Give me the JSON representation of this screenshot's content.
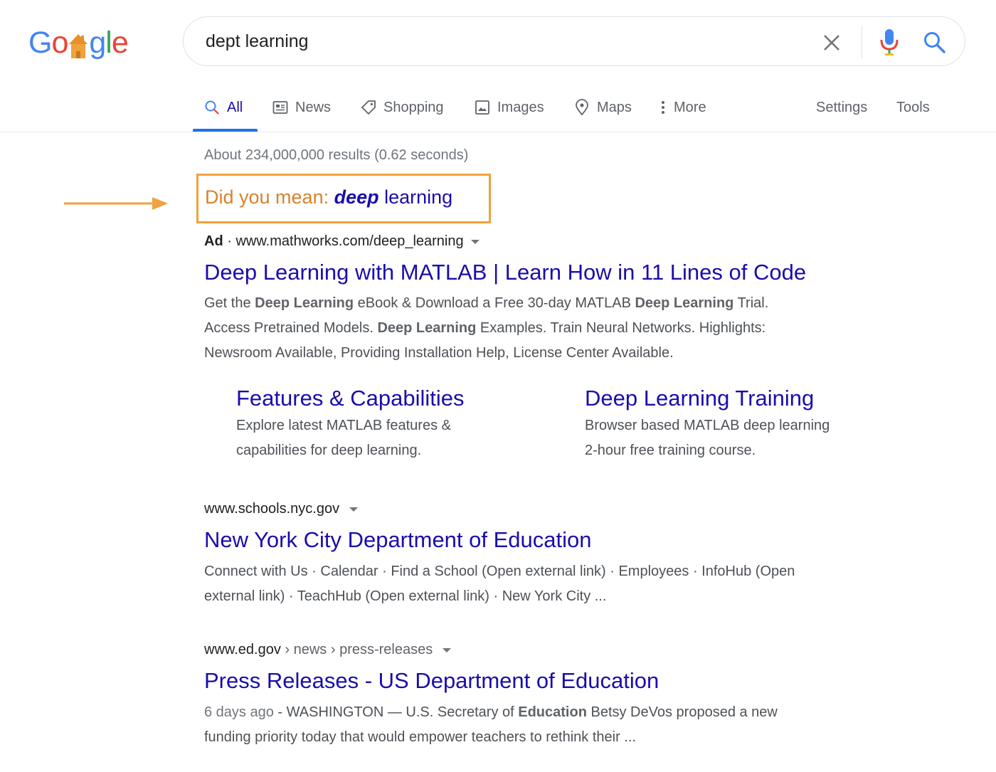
{
  "logo": {
    "letters": [
      "G",
      "o",
      "g",
      "l",
      "e"
    ],
    "colors": [
      "#4285f4",
      "#ea4335",
      "#fbbc05",
      "#4285f4",
      "#34a853",
      "#ea4335"
    ],
    "house_color": "#f0a23c"
  },
  "search": {
    "query": "dept learning"
  },
  "nav": {
    "tabs": [
      {
        "label": "All",
        "icon": "search-icon"
      },
      {
        "label": "News",
        "icon": "news-icon"
      },
      {
        "label": "Shopping",
        "icon": "tag-icon"
      },
      {
        "label": "Images",
        "icon": "image-icon"
      },
      {
        "label": "Maps",
        "icon": "map-pin-icon"
      },
      {
        "label": "More",
        "icon": "more-vert-icon"
      }
    ],
    "settings": "Settings",
    "tools": "Tools",
    "active_color": "#1a73e8"
  },
  "stats": "About 234,000,000 results (0.62 seconds)",
  "did_you_mean": {
    "prefix": "Did you mean: ",
    "bold_word": "deep",
    "rest": " learning",
    "highlight_color": "#f0a23c"
  },
  "ad": {
    "label": "Ad",
    "separator": " · ",
    "url": "www.mathworks.com/deep_learning",
    "title": "Deep Learning with MATLAB | Learn How in 11 Lines of Code",
    "snippet_lines": [
      [
        {
          "t": "Get the "
        },
        {
          "b": "Deep Learning"
        },
        {
          "t": " eBook & Download a Free 30-day MATLAB "
        },
        {
          "b": "Deep Learning"
        },
        {
          "t": " Trial."
        }
      ],
      [
        {
          "t": "Access Pretrained Models. "
        },
        {
          "b": "Deep Learning"
        },
        {
          "t": " Examples. Train Neural Networks. Highlights:"
        }
      ],
      [
        {
          "t": "Newsroom Available, Providing Installation Help, License Center Available."
        }
      ]
    ],
    "sitelinks": [
      {
        "title": "Features & Capabilities",
        "desc1": "Explore latest MATLAB features &",
        "desc2": "capabilities for deep learning."
      },
      {
        "title": "Deep Learning Training",
        "desc1": "Browser based MATLAB deep learning",
        "desc2": "2-hour free training course."
      }
    ]
  },
  "results": [
    {
      "url": "www.schools.nyc.gov",
      "crumbs": "",
      "title": "New York City Department of Education",
      "line1": "Connect with Us · Calendar · Find a School (Open external link) · Employees · InfoHub (Open",
      "line2": "external link) · TeachHub (Open external link) · New York City ..."
    },
    {
      "url": "www.ed.gov",
      "crumbs": " › news › press-releases",
      "title": "Press Releases - US Department of Education",
      "date": "6 days ago",
      "line1_a": " - WASHINGTON — U.S. Secretary of ",
      "line1_b": "Education",
      "line1_c": " Betsy DeVos proposed a new",
      "line2": "funding priority today that would empower teachers to rethink their ..."
    }
  ]
}
